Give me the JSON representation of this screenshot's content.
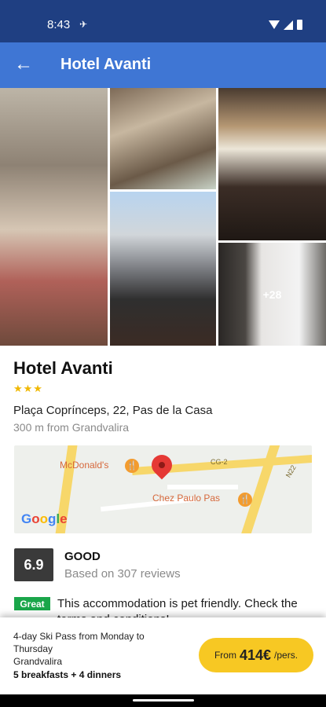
{
  "status_bar": {
    "time": "8:43",
    "icons": [
      "airplane-icon",
      "wifi-icon",
      "signal-icon",
      "battery-icon"
    ]
  },
  "app_bar": {
    "back_icon": "arrow-left-icon",
    "title": "Hotel Avanti"
  },
  "gallery": {
    "more_label": "+28",
    "photo_count": 5
  },
  "hotel": {
    "name": "Hotel Avanti",
    "stars": "★★★",
    "star_count": 3,
    "address": "Plaça Coprínceps, 22, Pas de la Casa",
    "distance": "300 m from Grandvalira"
  },
  "map": {
    "poi_1": "McDonald's",
    "poi_2": "Chez Paulo Pas",
    "road_1": "CG-2",
    "road_2": "N22",
    "logo": "Google",
    "pin_color": "#e53935"
  },
  "rating": {
    "score": "6.9",
    "label": "GOOD",
    "reviews": "Based on 307 reviews"
  },
  "pet_notice": {
    "badge": "Great",
    "text": "This accommodation is pet friendly. Check the terms and conditions!"
  },
  "package": {
    "title": "4-day Ski Pass from Monday to Thursday",
    "location": "Grandvalira",
    "meals": "5 breakfasts + 4 dinners"
  },
  "price": {
    "from_label": "From",
    "amount": "414€",
    "unit": "/pers."
  },
  "colors": {
    "status_bar": "#1f3f82",
    "app_bar": "#3f76d4",
    "star": "#f0b800",
    "badge_green": "#1aa64a",
    "price_button": "#f7c823",
    "score_box": "#3a3a3a"
  }
}
